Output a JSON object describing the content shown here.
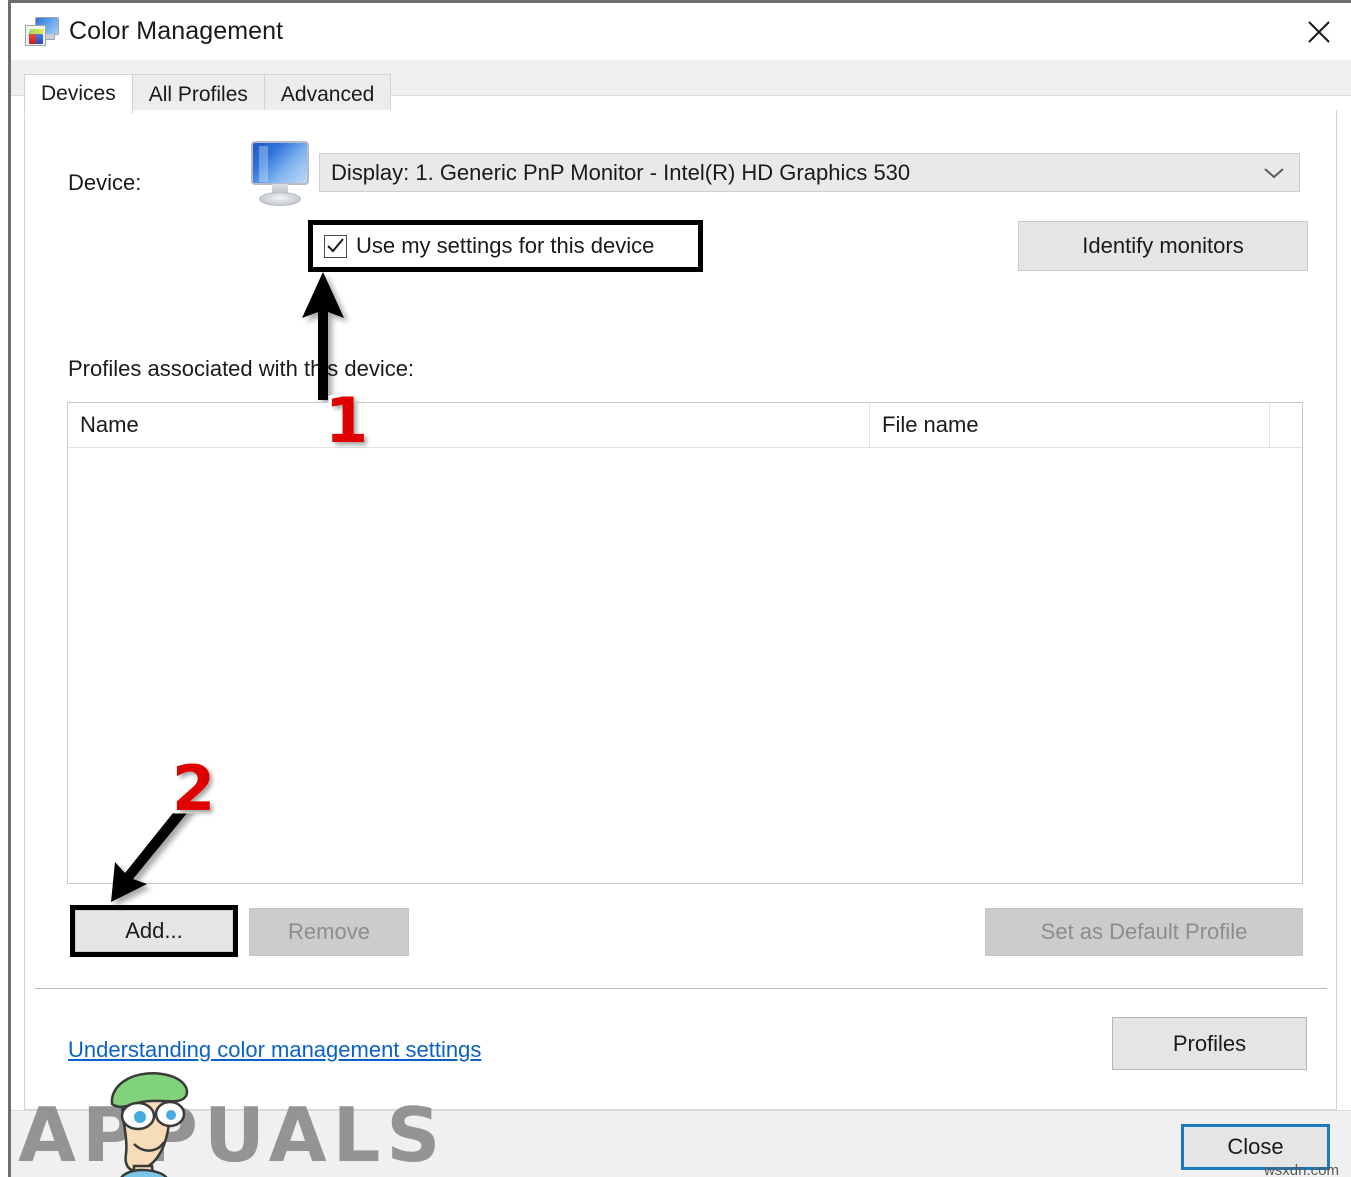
{
  "window": {
    "title": "Color Management",
    "icon": "color-management-icon",
    "close_icon": "close-icon"
  },
  "tabs": [
    {
      "label": "Devices",
      "active": true
    },
    {
      "label": "All Profiles",
      "active": false
    },
    {
      "label": "Advanced",
      "active": false
    }
  ],
  "device": {
    "label": "Device:",
    "icon": "monitor-icon",
    "selected": "Display: 1. Generic PnP Monitor - Intel(R) HD Graphics 530",
    "caret_icon": "chevron-down-icon",
    "use_my_settings": {
      "label": "Use my settings for this device",
      "checked": true,
      "highlighted": true
    },
    "identify_monitors": "Identify monitors"
  },
  "profiles": {
    "section_label": "Profiles associated with this device:",
    "columns": [
      "Name",
      "File name"
    ],
    "rows": []
  },
  "actions": {
    "add": "Add...",
    "remove": "Remove",
    "set_default": "Set as Default Profile",
    "add_highlighted": true,
    "remove_disabled": true,
    "set_default_disabled": true
  },
  "footer_links": {
    "help_link": "Understanding color management settings",
    "profiles_button": "Profiles"
  },
  "footer": {
    "close": "Close",
    "close_focused": true
  },
  "annotations": [
    {
      "number": "1",
      "type": "arrow-up",
      "target": "use-my-settings-checkbox"
    },
    {
      "number": "2",
      "type": "arrow-down-left",
      "target": "add-button"
    }
  ],
  "watermarks": {
    "brand": "APPUALS",
    "site": "wsxdn.com"
  },
  "colors": {
    "accent_blue": "#0b61c9",
    "focus_blue": "#1a7bbf",
    "annotation_red": "#e00000",
    "disabled_text": "#8d8d8d"
  }
}
